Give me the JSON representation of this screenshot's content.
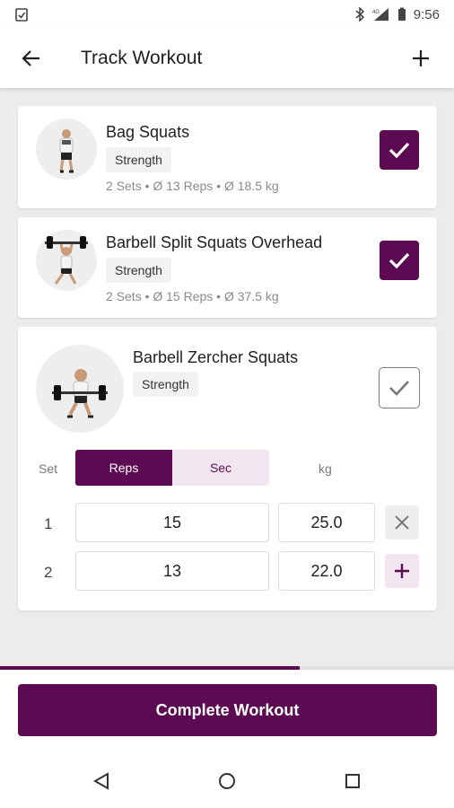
{
  "status_bar": {
    "time": "9:56",
    "icons": [
      "clipboard-check-icon",
      "bluetooth-icon",
      "signal-4g-icon",
      "battery-icon"
    ]
  },
  "app_bar": {
    "title": "Track Workout",
    "back_icon": "arrow-left-icon",
    "add_icon": "plus-icon"
  },
  "exercises": [
    {
      "name": "Bag Squats",
      "tag": "Strength",
      "stats": "2 Sets • Ø 13 Reps • Ø 18.5 kg",
      "completed": true
    },
    {
      "name": "Barbell Split Squats Overhead",
      "tag": "Strength",
      "stats": "2 Sets • Ø 15 Reps • Ø 37.5 kg",
      "completed": true
    },
    {
      "name": "Barbell Zercher Squats",
      "tag": "Strength",
      "completed": false,
      "table": {
        "set_label": "Set",
        "mode_options": [
          "Reps",
          "Sec"
        ],
        "selected_mode": "Reps",
        "unit_label": "kg",
        "sets": [
          {
            "number": "1",
            "reps": "15",
            "weight": "25.0",
            "action": "remove"
          },
          {
            "number": "2",
            "reps": "13",
            "weight": "22.0",
            "action": "add"
          }
        ]
      }
    }
  ],
  "progress": 0.66,
  "complete_button": "Complete Workout",
  "colors": {
    "accent": "#5c0a52",
    "accent_light": "#f1e6f0",
    "background": "#ececec"
  },
  "nav_icons": [
    "back-triangle-icon",
    "home-circle-icon",
    "recents-square-icon"
  ]
}
